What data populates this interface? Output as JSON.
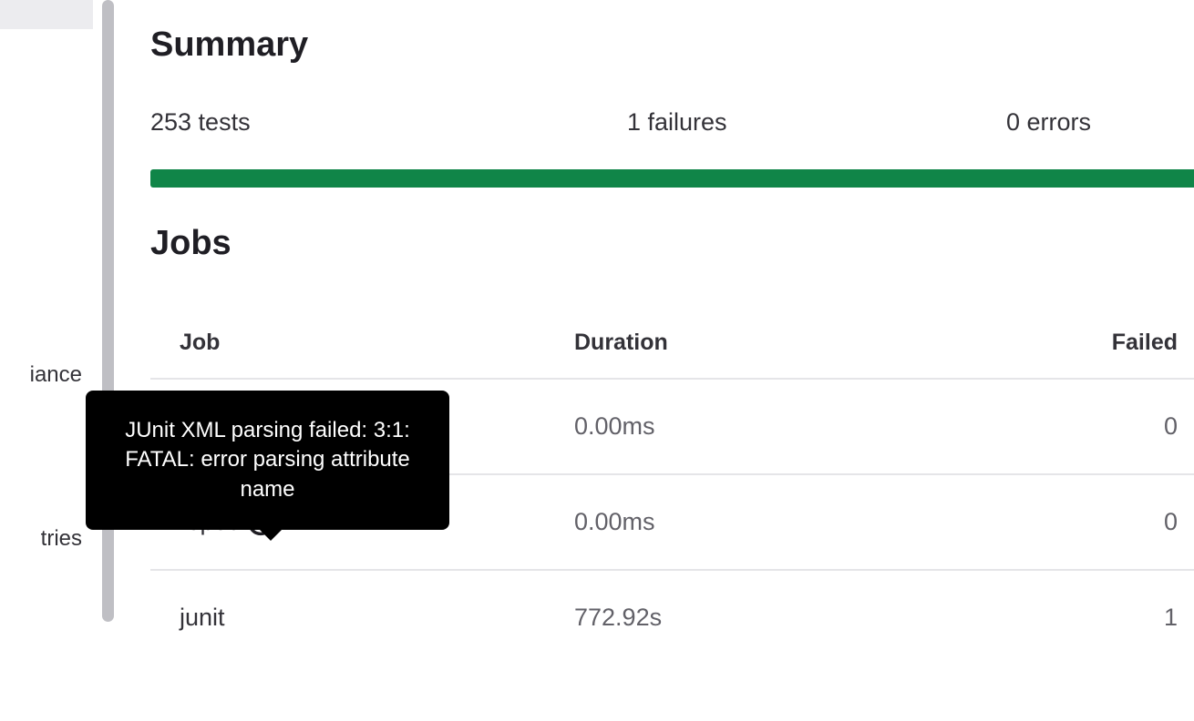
{
  "sidebar": {
    "items": [
      {
        "label": "iance"
      },
      {
        "label": "tries"
      }
    ]
  },
  "summary": {
    "title": "Summary",
    "tests_label": "253 tests",
    "failures_label": "1 failures",
    "errors_label": "0 errors"
  },
  "jobs": {
    "title": "Jobs",
    "headers": {
      "job": "Job",
      "duration": "Duration",
      "failed": "Failed"
    },
    "rows": [
      {
        "name": "",
        "duration": "0.00ms",
        "failed": "0",
        "has_warning": false
      },
      {
        "name": "rspec",
        "duration": "0.00ms",
        "failed": "0",
        "has_warning": true
      },
      {
        "name": "junit",
        "duration": "772.92s",
        "failed": "1",
        "has_warning": false
      }
    ]
  },
  "tooltip": {
    "text": "JUnit XML parsing failed: 3:1: FATAL: error parsing attribute name"
  }
}
